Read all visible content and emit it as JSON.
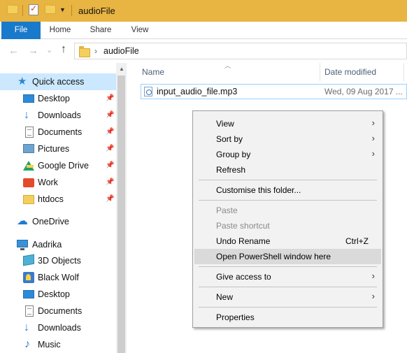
{
  "window": {
    "title": "audioFile",
    "quick_access_icons": [
      "folder-icon",
      "properties-icon",
      "new-folder-icon",
      "customize-qat-icon"
    ]
  },
  "ribbon": {
    "tabs": [
      {
        "label": "File"
      },
      {
        "label": "Home"
      },
      {
        "label": "Share"
      },
      {
        "label": "View"
      }
    ]
  },
  "address_bar": {
    "path": "audioFile",
    "separator": "›"
  },
  "nav": {
    "back": "←",
    "forward": "→",
    "recent": "⌄",
    "up": "↑"
  },
  "sidebar": {
    "items": [
      {
        "label": "Quick access",
        "icon": "star-icon"
      },
      {
        "label": "Desktop",
        "icon": "desktop-icon",
        "pinned": true
      },
      {
        "label": "Downloads",
        "icon": "downloads-icon",
        "pinned": true
      },
      {
        "label": "Documents",
        "icon": "documents-icon",
        "pinned": true
      },
      {
        "label": "Pictures",
        "icon": "pictures-icon",
        "pinned": true
      },
      {
        "label": "Google Drive",
        "icon": "google-drive-icon",
        "pinned": true
      },
      {
        "label": "Work",
        "icon": "work-folder-icon",
        "pinned": true
      },
      {
        "label": "htdocs",
        "icon": "folder-icon",
        "pinned": true
      },
      {
        "label": "OneDrive",
        "icon": "onedrive-icon"
      },
      {
        "label": "Aadrika",
        "icon": "this-pc-icon"
      },
      {
        "label": "3D Objects",
        "icon": "3d-objects-icon"
      },
      {
        "label": "Black Wolf",
        "icon": "black-wolf-icon"
      },
      {
        "label": "Desktop",
        "icon": "desktop-icon"
      },
      {
        "label": "Documents",
        "icon": "documents-icon"
      },
      {
        "label": "Downloads",
        "icon": "downloads-icon"
      },
      {
        "label": "Music",
        "icon": "music-icon"
      }
    ]
  },
  "filelist": {
    "columns": {
      "name": "Name",
      "date_modified": "Date modified"
    },
    "files": [
      {
        "name": "input_audio_file.mp3",
        "date_modified": "Wed, 09 Aug 2017 ..."
      }
    ]
  },
  "context_menu": {
    "items": {
      "view": "View",
      "sort_by": "Sort by",
      "group_by": "Group by",
      "refresh": "Refresh",
      "customise": "Customise this folder...",
      "paste": "Paste",
      "paste_shortcut": "Paste shortcut",
      "undo_rename": "Undo Rename",
      "undo_rename_shortcut": "Ctrl+Z",
      "powershell": "Open PowerShell window here",
      "give_access": "Give access to",
      "new": "New",
      "properties": "Properties"
    },
    "submenu_arrow": "›"
  }
}
